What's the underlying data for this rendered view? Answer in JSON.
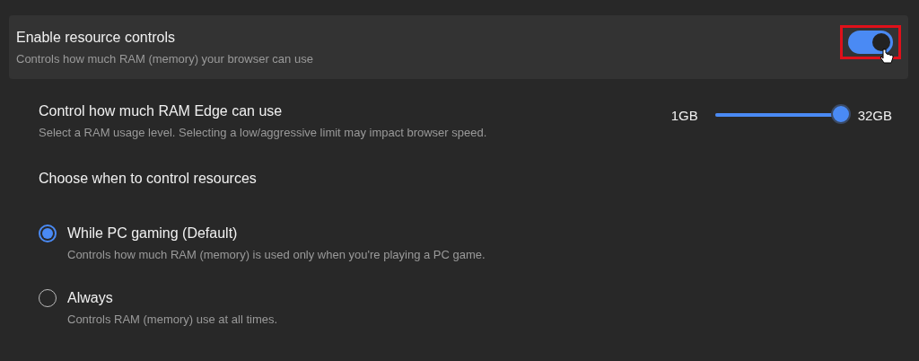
{
  "resource_controls": {
    "title": "Enable resource controls",
    "description": "Controls how much RAM (memory) your browser can use",
    "on": true,
    "highlighted": true
  },
  "ram_limit": {
    "title": "Control how much RAM Edge can use",
    "description": "Select a RAM usage level. Selecting a low/aggressive limit may impact browser speed.",
    "min_label": "1GB",
    "max_label": "32GB",
    "level": 1
  },
  "schedule": {
    "heading": "Choose when to control resources",
    "options": [
      {
        "label": "While PC gaming (Default)",
        "description": "Controls how much RAM (memory) is used only when you're playing a PC game.",
        "selected": true
      },
      {
        "label": "Always",
        "description": "Controls RAM (memory) use at all times.",
        "selected": false
      }
    ]
  }
}
